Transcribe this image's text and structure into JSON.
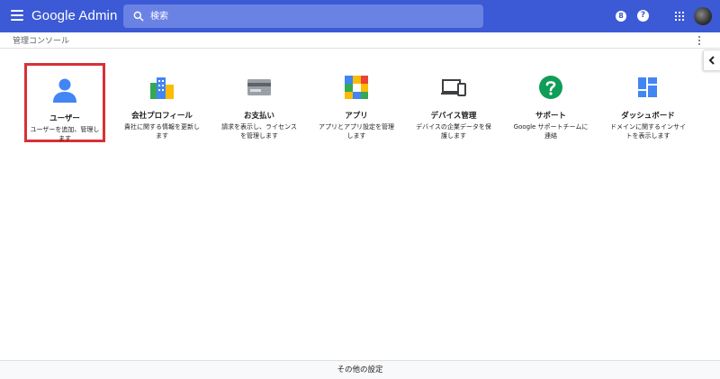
{
  "header": {
    "brand": "Google Admin",
    "search_placeholder": "検索",
    "notification_count": "8",
    "help_label": "?"
  },
  "breadcrumb": "管理コンソール",
  "tiles": [
    {
      "icon": "user-icon",
      "title": "ユーザー",
      "desc": "ユーザーを追加、管理します"
    },
    {
      "icon": "company-profile-icon",
      "title": "会社プロフィール",
      "desc": "貴社に関する情報を更新します"
    },
    {
      "icon": "billing-card-icon",
      "title": "お支払い",
      "desc": "請求を表示し、ライセンスを管理します"
    },
    {
      "icon": "apps-icon",
      "title": "アプリ",
      "desc": "アプリとアプリ設定を管理します"
    },
    {
      "icon": "devices-icon",
      "title": "デバイス管理",
      "desc": "デバイスの企業データを保護します"
    },
    {
      "icon": "support-icon",
      "title": "サポート",
      "desc": "Google サポートチームに連絡"
    },
    {
      "icon": "dashboard-icon",
      "title": "ダッシュボード",
      "desc": "ドメインに関するインサイトを表示します"
    }
  ],
  "footer": "その他の設定",
  "colors": {
    "header": "#3c5ad6",
    "selected_border": "#d93036",
    "user_icon": "#4285f4"
  }
}
